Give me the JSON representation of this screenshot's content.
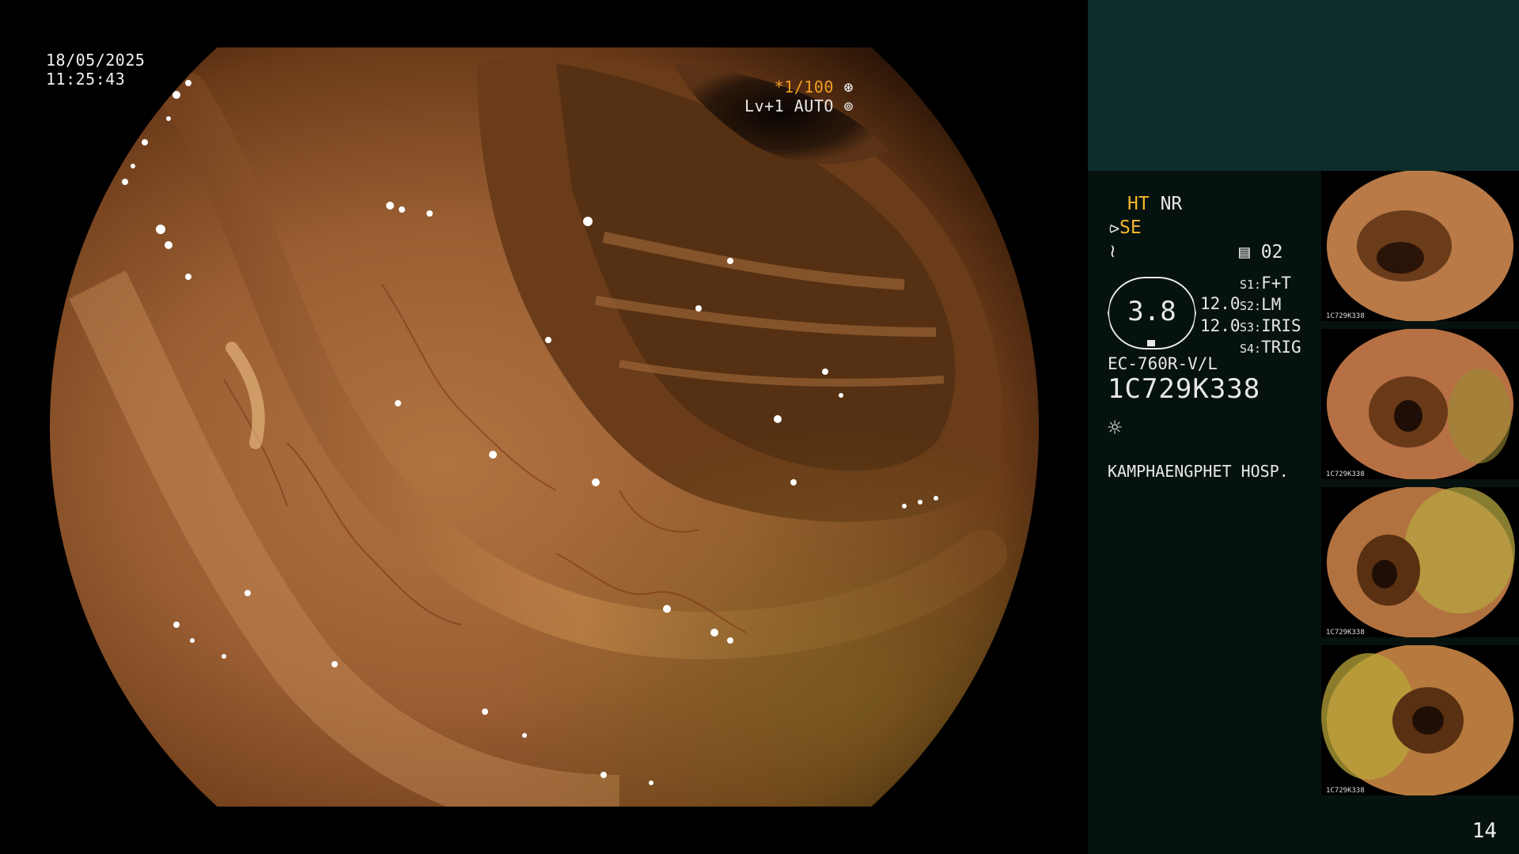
{
  "osd": {
    "date": "18/05/2025",
    "time": "11:25:43",
    "shutter_speed": "*1/100",
    "enhancement": "Lv+1 AUTO"
  },
  "panel": {
    "mode_ht": "HT",
    "mode_nr": "NR",
    "mode_se": "SE",
    "freeze_label": "02",
    "gauge_value": "3.8",
    "gauge_right_1": "12.0",
    "gauge_right_2": "12.0",
    "switches": [
      {
        "key": "S1:",
        "value": "F+T"
      },
      {
        "key": "S2:",
        "value": "LM"
      },
      {
        "key": "S3:",
        "value": "IRIS"
      },
      {
        "key": "S4:",
        "value": "TRIG"
      }
    ],
    "scope_model": "EC-760R-V/L",
    "scope_serial": "1C729K338",
    "hospital": "KAMPHAENGPHET HOSP.",
    "icons": [
      "scope-lever-icon",
      "wave-icon",
      "memory-icon",
      "light-sun-icon",
      "shutter-icon",
      "auto-icon"
    ]
  },
  "thumbnails": [
    {
      "label": "1C729K338"
    },
    {
      "label": "1C729K338"
    },
    {
      "label": "1C729K338"
    },
    {
      "label": "1C729K338"
    }
  ],
  "frame_counter": "14"
}
